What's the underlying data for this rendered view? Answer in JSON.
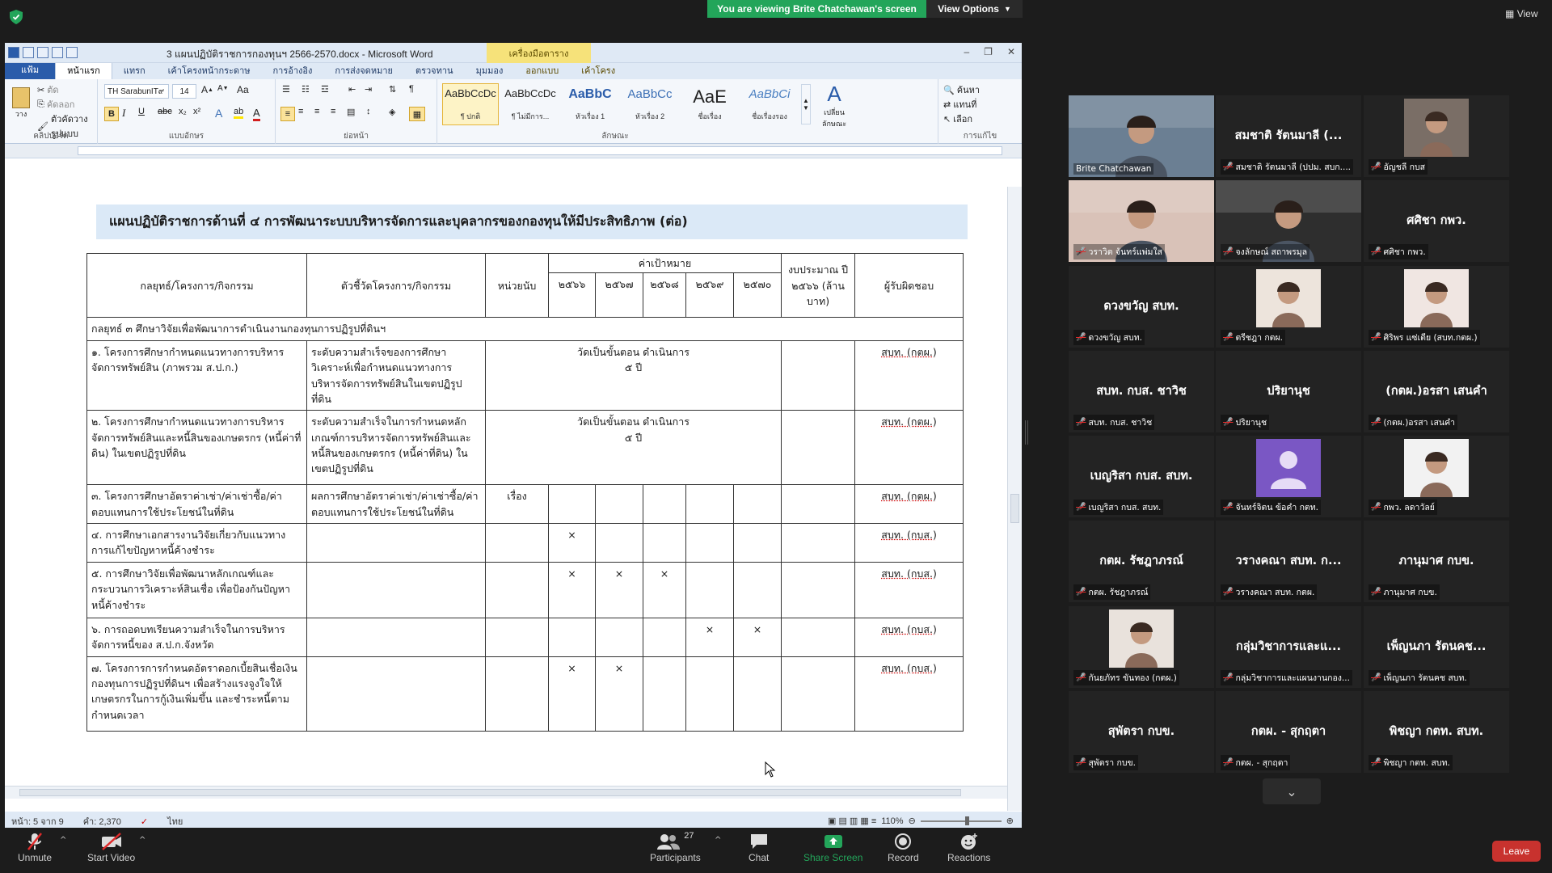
{
  "zoom": {
    "share_banner": "You are viewing Brite Chatchawan's screen",
    "view_options": "View Options",
    "view_label": "View",
    "bottom": {
      "unmute": "Unmute",
      "start_video": "Start Video",
      "participants": "Participants",
      "participant_count": "27",
      "chat": "Chat",
      "share_screen": "Share Screen",
      "record": "Record",
      "reactions": "Reactions",
      "leave": "Leave"
    },
    "tiles": [
      {
        "name": "",
        "label": "Brite Chatchawan",
        "muted": false,
        "video": true,
        "speaking": true
      },
      {
        "name": "สมชาติ รัตนมาลี (...",
        "label": "สมชาติ รัตนมาลี (ปปม. สบก....",
        "muted": true,
        "video": false
      },
      {
        "name": "",
        "label": "อัญชลี กบส",
        "muted": true,
        "video": true
      },
      {
        "name": "",
        "label": "วราวิต จันทร์แพ่มใส",
        "muted": true,
        "video": true
      },
      {
        "name": "",
        "label": "จงลักษณ์ สถาพรมุล",
        "muted": true,
        "video": true
      },
      {
        "name": "ศศิชา กพว.",
        "label": "ศศิชา กพว.",
        "muted": true,
        "video": false
      },
      {
        "name": "ดวงขวัญ สบท.",
        "label": "ดวงขวัญ สบท.",
        "muted": true,
        "video": false
      },
      {
        "name": "",
        "label": "ตรีชฎา กตผ.",
        "muted": true,
        "video": true
      },
      {
        "name": "",
        "label": "ศิริพร แซ่เตีย (สบท.กตผ.)",
        "muted": true,
        "video": true
      },
      {
        "name": "สบท. กบส. ชาวิช",
        "label": "สบท. กบส. ชาวิช",
        "muted": true,
        "video": false
      },
      {
        "name": "ปริยานุช",
        "label": "ปริยานุช",
        "muted": true,
        "video": false
      },
      {
        "name": "(กตผ.)อรสา เสนคำ",
        "label": "(กตผ.)อรสา เสนคำ",
        "muted": true,
        "video": false
      },
      {
        "name": "เบญริสา กบส. สบท.",
        "label": "เบญริสา กบส. สบท.",
        "muted": true,
        "video": false
      },
      {
        "name": "",
        "label": "จันทร์จิตน ข้อคำ กตท.",
        "muted": true,
        "video": true
      },
      {
        "name": "",
        "label": "กพว. ลดาวัลย์",
        "muted": true,
        "video": true
      },
      {
        "name": "กตผ. รัชฎาภรณ์",
        "label": "กตผ. รัชฎาภรณ์",
        "muted": true,
        "video": false
      },
      {
        "name": "วรางคณา สบท. ก...",
        "label": "วรางคณา สบท. กตผ.",
        "muted": true,
        "video": false
      },
      {
        "name": "ภานุมาศ กบข.",
        "label": "ภานุมาศ กบข.",
        "muted": true,
        "video": false
      },
      {
        "name": "",
        "label": "กันยภัทร ขันทอง (กตผ.)",
        "muted": true,
        "video": true
      },
      {
        "name": "กลุ่มวิชาการและแ...",
        "label": "กลุ่มวิชาการและแผนงานกอง...",
        "muted": true,
        "video": false
      },
      {
        "name": "เพ็ญนภา รัตนคช...",
        "label": "เพ็ญนภา รัตนคช สบท.",
        "muted": true,
        "video": false
      },
      {
        "name": "สุพัตรา กบข.",
        "label": "สุพัตรา กบข.",
        "muted": true,
        "video": false
      },
      {
        "name": "กตผ. - สุกฤตา",
        "label": "กตผ. - สุกฤตา",
        "muted": true,
        "video": false
      },
      {
        "name": "พิชญา กตท. สบท.",
        "label": "พิชญา กตท. สบท.",
        "muted": true,
        "video": false
      }
    ]
  },
  "word": {
    "title": "3 แผนปฏิบัติราชการกองทุนฯ 2566-2570.docx - Microsoft Word",
    "table_tools": "เครื่องมือตาราง",
    "tabs": [
      "แฟ้ม",
      "หน้าแรก",
      "แทรก",
      "เค้าโครงหน้ากระดาษ",
      "การอ้างอิง",
      "การส่งจดหมาย",
      "ตรวจทาน",
      "มุมมอง",
      "ออกแบบ",
      "เค้าโครง"
    ],
    "ribbon": {
      "paste": "วาง",
      "cut": "ตัด",
      "copy": "คัดลอก",
      "format_painter": "ตัวคัดวางรูปแบบ",
      "clipboard": "คลิปบอร์ด",
      "font_name": "TH SarabunIT๙",
      "font_size": "14",
      "font_group": "แบบอักษร",
      "paragraph_group": "ย่อหน้า",
      "styles_group": "ลักษณะ",
      "editing_group": "การแก้ไข",
      "styles": [
        {
          "preview": "AaBbCcDc",
          "caption": "¶ ปกติ"
        },
        {
          "preview": "AaBbCcDc",
          "caption": "¶ ไม่มีการ..."
        },
        {
          "preview": "AaBbC",
          "caption": "หัวเรื่อง 1"
        },
        {
          "preview": "AaBbCc",
          "caption": "หัวเรื่อง 2"
        },
        {
          "preview": "AaE",
          "caption": "ชื่อเรื่อง"
        },
        {
          "preview": "AaBbCi",
          "caption": "ชื่อเรื่องรอง"
        }
      ],
      "change_styles": "เปลี่ยนลักษณะ",
      "find": "ค้นหา",
      "replace": "แทนที่",
      "select": "เลือก"
    },
    "status": {
      "page": "หน้า: 5 จาก 9",
      "words": "คำ: 2,370",
      "language": "ไทย",
      "zoom": "110%"
    },
    "doc": {
      "heading": "แผนปฏิบัติราชการด้านที่ ๔ การพัฒนาระบบบริหารจัดการและบุคลากรของกองทุนให้มีประสิทธิภาพ (ต่อ)",
      "headers": {
        "strategy": "กลยุทธ์/โครงการ/กิจกรรม",
        "indicator": "ตัวชี้วัดโครงการ/กิจกรรม",
        "unit": "หน่วยนับ",
        "target": "ค่าเป้าหมาย",
        "years": [
          "๒๕๖๖",
          "๒๕๖๗",
          "๒๕๖๘",
          "๒๕๖๙",
          "๒๕๗๐"
        ],
        "budget": "งบประมาณ ปี ๒๕๖๖ (ล้านบาท)",
        "responsible": "ผู้รับผิดชอบ"
      },
      "section": "กลยุทธ์ ๓ ศึกษาวิจัยเพื่อพัฒนาการดำเนินงานกองทุนการปฏิรูปที่ดินฯ",
      "rows": [
        {
          "project": "๑. โครงการศึกษากำหนดแนวทางการบริหารจัดการทรัพย์สิน (ภาพรวม ส.ป.ก.)",
          "indicator": "ระดับความสำเร็จของการศึกษาวิเคราะห์เพื่อกำหนดแนวทางการบริหารจัดการทรัพย์สินในเขตปฏิรูปที่ดิน",
          "unit": "",
          "merged": "วัดเป็นขั้นตอน ดำเนินการ ๕ ปี",
          "marks": [
            "",
            "",
            "",
            "",
            ""
          ],
          "responsible": "สบท. (กตผ.)"
        },
        {
          "project": "๒. โครงการศึกษากำหนดแนวทางการบริหารจัดการทรัพย์สินและหนี้สินของเกษตรกร (หนี้ค่าที่ดิน) ในเขตปฏิรูปที่ดิน",
          "indicator": "ระดับความสำเร็จในการกำหนดหลักเกณฑ์การบริหารจัดการทรัพย์สินและหนี้สินของเกษตรกร (หนี้ค่าที่ดิน) ในเขตปฏิรูปที่ดิน",
          "unit": "",
          "merged": "วัดเป็นขั้นตอน ดำเนินการ ๕ ปี",
          "marks": [
            "",
            "",
            "",
            "",
            ""
          ],
          "responsible": "สบท. (กตผ.)"
        },
        {
          "project": "๓. โครงการศึกษาอัตราค่าเช่า/ค่าเช่าซื้อ/ค่าตอบแทนการใช้ประโยชน์ในที่ดิน",
          "indicator": "ผลการศึกษาอัตราค่าเช่า/ค่าเช่าซื้อ/ค่าตอบแทนการใช้ประโยชน์ในที่ดิน",
          "unit": "เรื่อง",
          "merged": "",
          "marks": [
            "",
            "",
            "",
            "",
            ""
          ],
          "responsible": "สบท. (กตผ.)"
        },
        {
          "project": "๔. การศึกษาเอกสารงานวิจัยเกี่ยวกับแนวทางการแก้ไขปัญหาหนี้ค้างชำระ",
          "indicator": "",
          "unit": "",
          "merged": "",
          "marks": [
            "×",
            "",
            "",
            "",
            ""
          ],
          "responsible": "สบท. (กบส.)"
        },
        {
          "project": "๕. การศึกษาวิจัยเพื่อพัฒนาหลักเกณฑ์และกระบวนการวิเคราะห์สินเชื่อ เพื่อป้องกันปัญหาหนี้ค้างชำระ",
          "indicator": "",
          "unit": "",
          "merged": "",
          "marks": [
            "×",
            "×",
            "×",
            "",
            ""
          ],
          "responsible": "สบท. (กบส.)"
        },
        {
          "project": "๖. การถอดบทเรียนความสำเร็จในการบริหารจัดการหนี้ของ ส.ป.ก.จังหวัด",
          "indicator": "",
          "unit": "",
          "merged": "",
          "marks": [
            "",
            "",
            "",
            "×",
            "×"
          ],
          "responsible": "สบท. (กบส.)"
        },
        {
          "project": "๗. โครงการการกำหนดอัตราดอกเบี้ยสินเชื่อเงินกองทุนการปฏิรูปที่ดินฯ เพื่อสร้างแรงจูงใจให้เกษตรกรในการกู้เงินเพิ่มขึ้น และชำระหนี้ตามกำหนดเวลา",
          "indicator": "",
          "unit": "",
          "merged": "",
          "marks": [
            "×",
            "×",
            "",
            "",
            ""
          ],
          "responsible": "สบท. (กบส.)"
        }
      ]
    }
  }
}
